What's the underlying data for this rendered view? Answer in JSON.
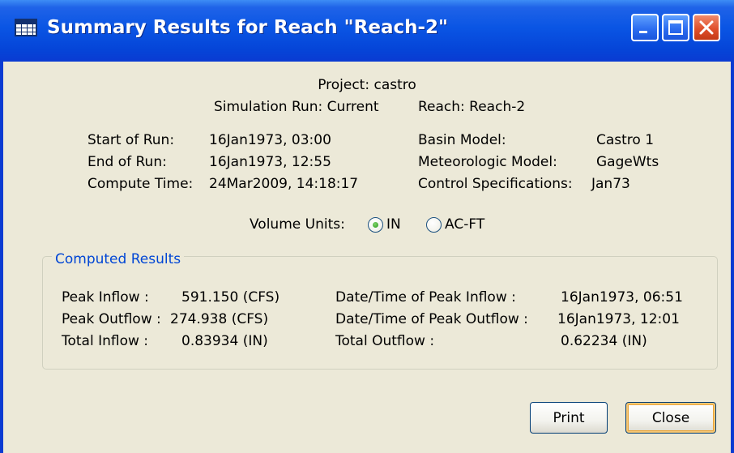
{
  "window": {
    "title": "Summary Results for Reach \"Reach-2\""
  },
  "header": {
    "project": "Project: castro",
    "simulation_run": "Simulation Run: Current",
    "reach": "Reach: Reach-2"
  },
  "run_info": {
    "start_label": "Start of Run:",
    "start_value": "16Jan1973, 03:00",
    "end_label": "End of Run:",
    "end_value": "16Jan1973, 12:55",
    "compute_label": "Compute Time:",
    "compute_value": "24Mar2009, 14:18:17",
    "basin_label": "Basin Model:",
    "basin_value": "Castro 1",
    "met_label": "Meteorologic Model:",
    "met_value": "GageWts",
    "control_label": "Control Specifications:",
    "control_value": "Jan73"
  },
  "volume_units": {
    "label": "Volume Units:",
    "options": [
      "IN",
      "AC-FT"
    ],
    "selected": "IN"
  },
  "computed_results": {
    "title": "Computed Results",
    "peak_inflow_label": "Peak Inflow :",
    "peak_inflow_value": "591.150 (CFS)",
    "peak_outflow_label": "Peak Outflow :",
    "peak_outflow_value": "274.938 (CFS)",
    "total_inflow_label": "Total Inflow :",
    "total_inflow_value": "0.83934 (IN)",
    "peak_inflow_time_label": "Date/Time of Peak Inflow :",
    "peak_inflow_time_value": "16Jan1973, 06:51",
    "peak_outflow_time_label": "Date/Time of Peak Outflow :",
    "peak_outflow_time_value": "16Jan1973, 12:01",
    "total_outflow_label": "Total Outflow :",
    "total_outflow_value": "0.62234 (IN)"
  },
  "buttons": {
    "print": "Print",
    "close": "Close"
  }
}
